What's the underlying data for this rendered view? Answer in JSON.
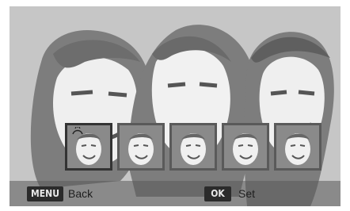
{
  "screen": {
    "background_color": "#c6c6c6",
    "faces": [
      {
        "position": "left",
        "icon": "face-silhouette-icon"
      },
      {
        "position": "center",
        "icon": "face-silhouette-icon"
      },
      {
        "position": "right",
        "icon": "face-silhouette-icon"
      }
    ]
  },
  "face_strip": {
    "thumbnails": [
      {
        "selected": true,
        "marker_icon": "smile-icon"
      },
      {
        "selected": false
      },
      {
        "selected": false
      },
      {
        "selected": false
      },
      {
        "selected": false
      }
    ]
  },
  "bottom_bar": {
    "back_key": "MENU",
    "back_label": "Back",
    "set_key": "OK",
    "set_label": "Set"
  }
}
